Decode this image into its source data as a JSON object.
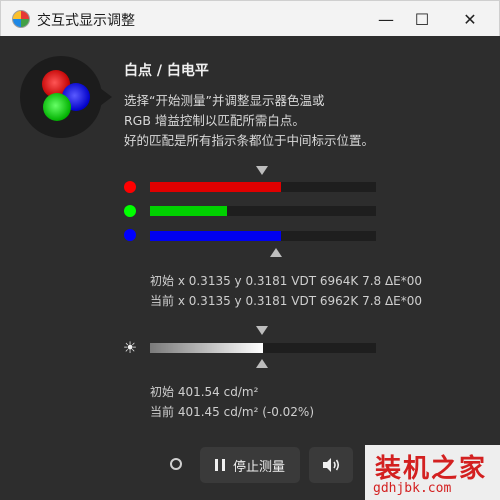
{
  "window": {
    "title": "交互式显示调整",
    "minimize": "—",
    "maximize": "☐",
    "close": "✕"
  },
  "header": {
    "section_title": "白点 / 白电平",
    "instructions": [
      "选择“开始测量”并调整显示器色温或",
      "RGB 增益控制以匹配所需白点。",
      "好的匹配是所有指示条都位于中间标示位置。"
    ]
  },
  "rgb_bars": [
    {
      "name": "red",
      "color": "#e00000",
      "dot_color": "#ff0000",
      "value": 0.58
    },
    {
      "name": "green",
      "color": "#00d000",
      "dot_color": "#00ff00",
      "value": 0.34
    },
    {
      "name": "blue",
      "color": "#0000f0",
      "dot_color": "#0000ff",
      "value": 0.58
    }
  ],
  "rgb_readout": {
    "initial": "初始 x 0.3135 y 0.3181 VDT 6964K 7.8 ΔE*00",
    "current": "当前 x 0.3135 y 0.3181 VDT 6962K 7.8 ΔE*00"
  },
  "luminance_bar": {
    "value": 0.5
  },
  "luminance_readout": {
    "initial": "初始 401.54 cd/m²",
    "current": "当前 401.45 cd/m² (-0.02%)"
  },
  "controls": {
    "stop_label": "停止测量"
  },
  "watermark": {
    "main": "装机之家",
    "sub": "gdhjbk.com"
  }
}
